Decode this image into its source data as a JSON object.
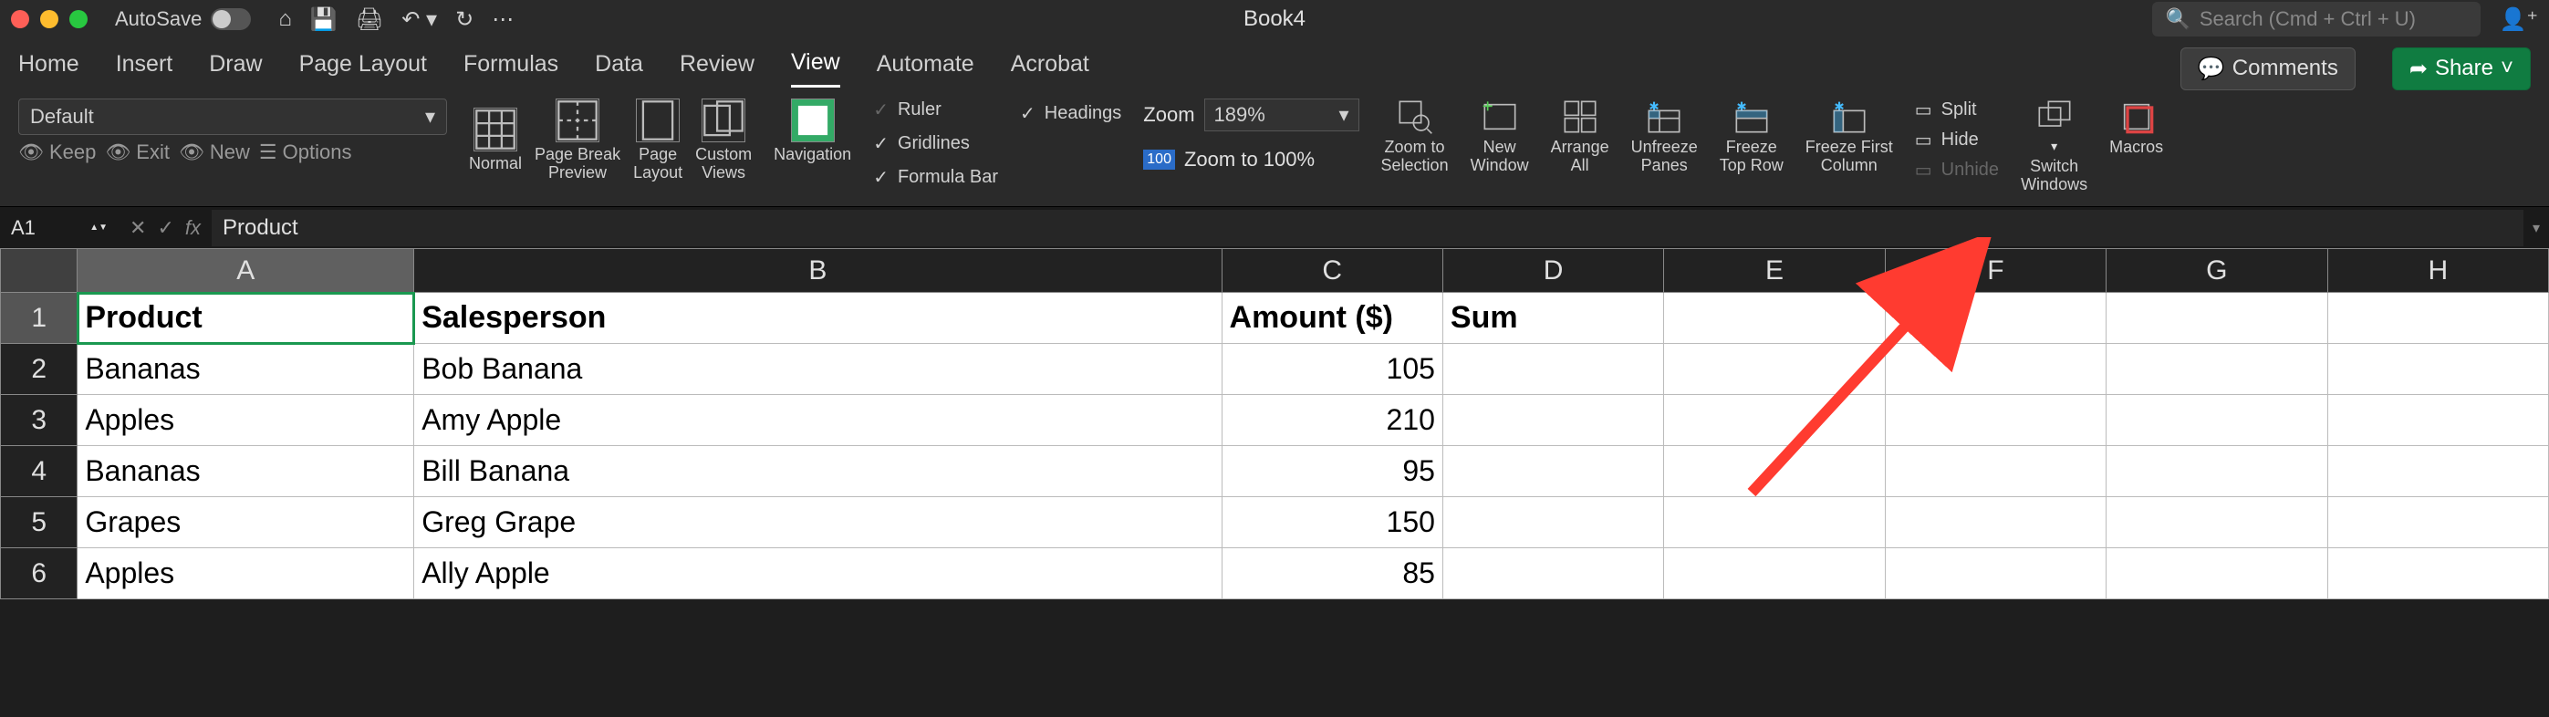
{
  "titlebar": {
    "autosave_label": "AutoSave",
    "doc_title": "Book4",
    "search_placeholder": "Search (Cmd + Ctrl + U)"
  },
  "tabs": {
    "items": [
      "Home",
      "Insert",
      "Draw",
      "Page Layout",
      "Formulas",
      "Data",
      "Review",
      "View",
      "Automate",
      "Acrobat"
    ],
    "active": "View",
    "comments_label": "Comments",
    "share_label": "Share"
  },
  "ribbon": {
    "style_default": "Default",
    "keep": "Keep",
    "exit": "Exit",
    "new": "New",
    "options": "Options",
    "normal": "Normal",
    "page_break": "Page Break\nPreview",
    "page_layout": "Page\nLayout",
    "custom_views": "Custom\nViews",
    "navigation": "Navigation",
    "ruler": "Ruler",
    "gridlines": "Gridlines",
    "formula_bar": "Formula Bar",
    "headings": "Headings",
    "zoom_label": "Zoom",
    "zoom_value": "189%",
    "zoom_100": "Zoom to 100%",
    "zoom_selection": "Zoom to\nSelection",
    "new_window": "New\nWindow",
    "arrange_all": "Arrange\nAll",
    "unfreeze": "Unfreeze\nPanes",
    "freeze_top": "Freeze\nTop Row",
    "freeze_first": "Freeze First\nColumn",
    "split": "Split",
    "hide": "Hide",
    "unhide": "Unhide",
    "switch_windows": "Switch\nWindows",
    "macros": "Macros"
  },
  "formula": {
    "cell_ref": "A1",
    "fx": "fx",
    "content": "Product"
  },
  "columns": [
    "A",
    "B",
    "C",
    "D",
    "E",
    "F",
    "G",
    "H"
  ],
  "rows": [
    {
      "n": "1",
      "cells": [
        "Product",
        "Salesperson",
        "Amount ($)",
        "Sum",
        "",
        "",
        "",
        ""
      ],
      "header": true,
      "selected_cell": 0
    },
    {
      "n": "2",
      "cells": [
        "Bananas",
        "Bob Banana",
        "105",
        "",
        "",
        "",
        "",
        ""
      ]
    },
    {
      "n": "3",
      "cells": [
        "Apples",
        "Amy Apple",
        "210",
        "",
        "",
        "",
        "",
        ""
      ]
    },
    {
      "n": "4",
      "cells": [
        "Bananas",
        "Bill Banana",
        "95",
        "",
        "",
        "",
        "",
        ""
      ]
    },
    {
      "n": "5",
      "cells": [
        "Grapes",
        "Greg Grape",
        "150",
        "",
        "",
        "",
        "",
        ""
      ]
    },
    {
      "n": "6",
      "cells": [
        "Apples",
        "Ally Apple",
        "85",
        "",
        "",
        "",
        "",
        ""
      ]
    }
  ]
}
